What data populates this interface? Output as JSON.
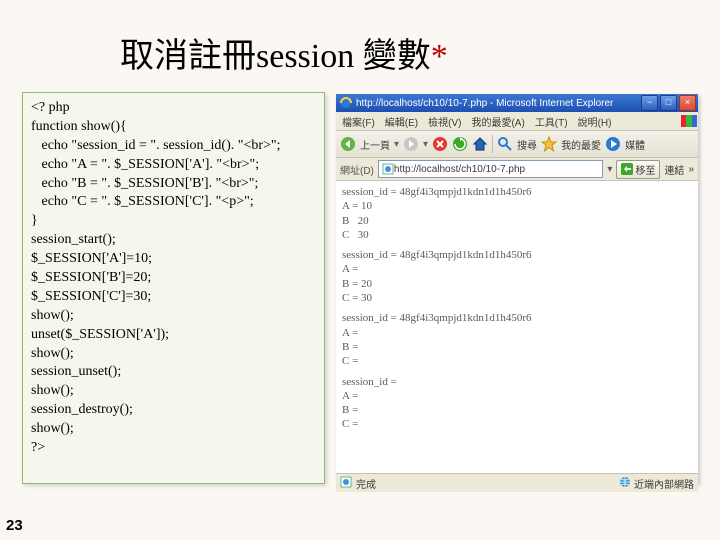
{
  "title_main": "取消註冊session 變數",
  "title_star": "*",
  "code": "<? php\nfunction show(){\n   echo \"session_id = \". session_id(). \"<br>\";\n   echo \"A = \". $_SESSION['A']. \"<br>\";\n   echo \"B = \". $_SESSION['B']. \"<br>\";\n   echo \"C = \". $_SESSION['C']. \"<p>\";\n}\nsession_start();\n$_SESSION['A']=10;\n$_SESSION['B']=20;\n$_SESSION['C']=30;\nshow();\nunset($_SESSION['A']);\nshow();\nsession_unset();\nshow();\nsession_destroy();\nshow();\n?>",
  "browser": {
    "window_title": "http://localhost/ch10/10-7.php - Microsoft Internet Explorer",
    "menu": [
      "檔案(F)",
      "編輯(E)",
      "檢視(V)",
      "我的最愛(A)",
      "工具(T)",
      "說明(H)"
    ],
    "toolbar": {
      "back": "上一頁",
      "search": "搜尋",
      "fav": "我的最愛",
      "media": "媒體"
    },
    "addr_label": "網址(D)",
    "addr_value": "http://localhost/ch10/10-7.php",
    "go_label": "移至",
    "link_label": "連結",
    "chevron": "»",
    "page_blocks": [
      "session_id = 48gf4i3qmpjd1kdn1d1h450r6\nA = 10\nB   20\nC   30",
      "session_id = 48gf4i3qmpjd1kdn1d1h450r6\nA =\nB = 20\nC = 30",
      "session_id = 48gf4i3qmpjd1kdn1d1h450r6\nA =\nB =\nC =",
      "session_id =\nA =\nB =\nC ="
    ],
    "status_done": "完成",
    "status_zone": "近端內部網路"
  },
  "slide_number": "23"
}
